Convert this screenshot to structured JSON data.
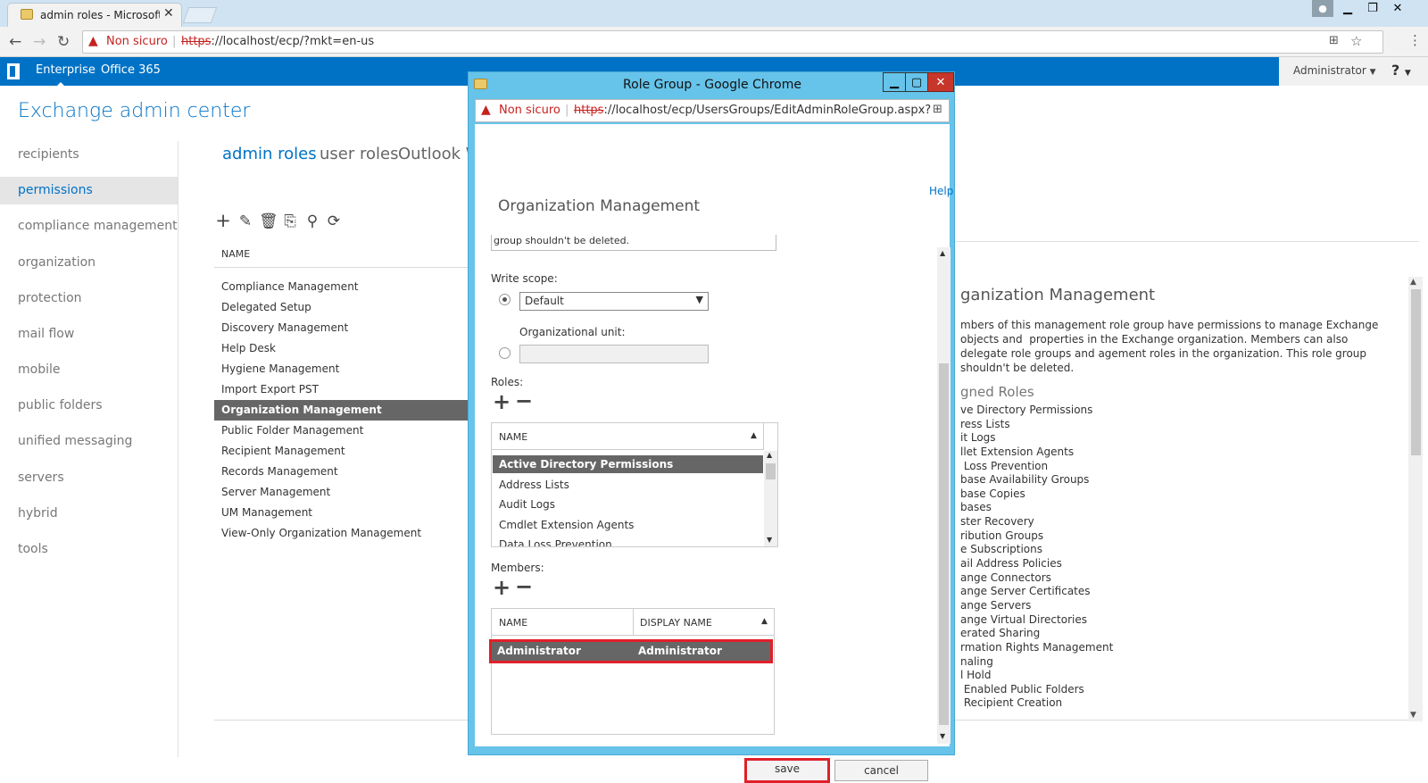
{
  "browser": {
    "tab_title": "admin roles - Microsoft E",
    "tab_close": "✕",
    "not_secure": "Non sicuro",
    "url_https": "https",
    "url_rest": "://localhost/ecp/?mkt=en-us"
  },
  "eac": {
    "nav_enterprise": "Enterprise",
    "nav_office365": "Office 365",
    "admin_label": "Administrator",
    "help_glyph": "?",
    "title": "Exchange admin center"
  },
  "leftnav": [
    "recipients",
    "permissions",
    "compliance management",
    "organization",
    "protection",
    "mail flow",
    "mobile",
    "public folders",
    "unified messaging",
    "servers",
    "hybrid",
    "tools"
  ],
  "subtabs": [
    "admin roles",
    "user roles",
    "Outlook W"
  ],
  "list": {
    "header": "NAME",
    "rows": [
      "Compliance Management",
      "Delegated Setup",
      "Discovery Management",
      "Help Desk",
      "Hygiene Management",
      "Import Export PST",
      "Organization Management",
      "Public Folder Management",
      "Recipient Management",
      "Records Management",
      "Server Management",
      "UM Management",
      "View-Only Organization Management"
    ]
  },
  "details": {
    "title": "ganization Management",
    "description": "mbers of this management role group have permissions to manage Exchange objects and  properties in the Exchange organization. Members can also delegate role groups and agement roles in the organization. This role group shouldn't be deleted.",
    "assigned_label": "gned Roles",
    "roles": [
      "ve Directory Permissions",
      "ress Lists",
      "it Logs",
      "llet Extension Agents",
      " Loss Prevention",
      "base Availability Groups",
      "base Copies",
      "bases",
      "ster Recovery",
      "ribution Groups",
      "e Subscriptions",
      "ail Address Policies",
      "ange Connectors",
      "ange Server Certificates",
      "ange Servers",
      "ange Virtual Directories",
      "erated Sharing",
      "rmation Rights Management",
      "naling",
      "l Hold",
      " Enabled Public Folders",
      " Recipient Creation"
    ]
  },
  "popup": {
    "title": "Role Group - Google Chrome",
    "not_secure": "Non sicuro",
    "url_https": "https",
    "url_rest": "://localhost/ecp/UsersGroups/EditAdminRoleGroup.aspx?pwn",
    "help": "Help",
    "heading": "Organization Management",
    "description_tail": "group shouldn't be deleted.",
    "write_scope_label": "Write scope:",
    "write_scope_value": "Default",
    "ou_label": "Organizational unit:",
    "roles_label": "Roles:",
    "roles_header": "NAME",
    "roles": [
      "Active Directory Permissions",
      "Address Lists",
      "Audit Logs",
      "Cmdlet Extension Agents",
      "Data Loss Prevention"
    ],
    "members_label": "Members:",
    "members_col_name": "NAME",
    "members_col_display": "DISPLAY NAME",
    "members": [
      {
        "name": "Administrator",
        "display": "Administrator"
      }
    ],
    "save": "save",
    "cancel": "cancel"
  }
}
